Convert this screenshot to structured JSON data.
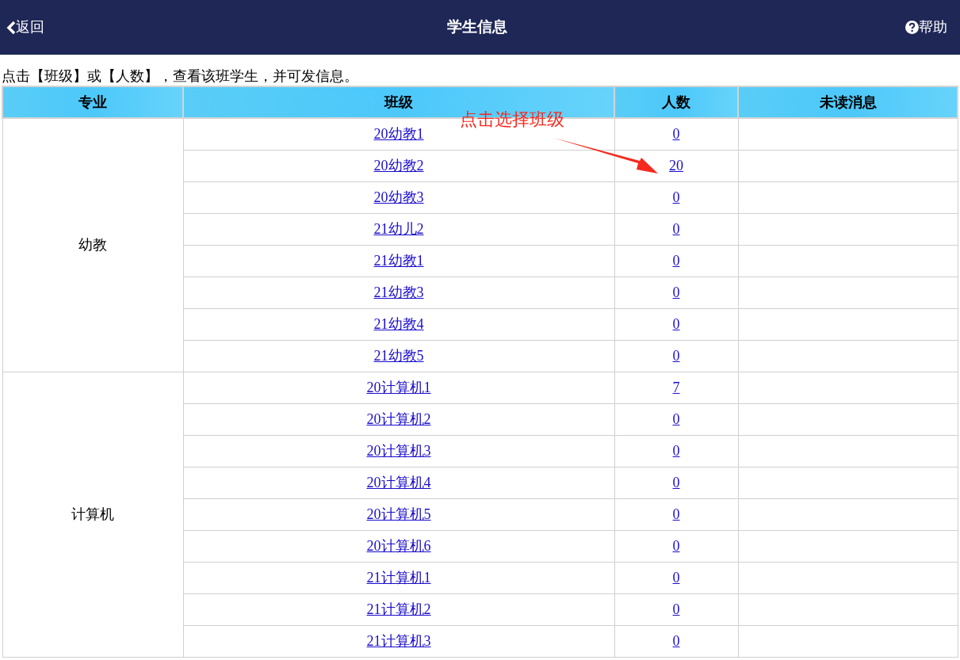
{
  "header": {
    "back": "返回",
    "title": "学生信息",
    "help": "帮助"
  },
  "instruction": "点击【班级】或【人数】，查看该班学生，并可发信息。",
  "table": {
    "columns": [
      "专业",
      "班级",
      "人数",
      "未读消息"
    ],
    "groups": [
      {
        "major": "幼教",
        "rows": [
          {
            "class": "20幼教1",
            "count": "0"
          },
          {
            "class": "20幼教2",
            "count": "20"
          },
          {
            "class": "20幼教3",
            "count": "0"
          },
          {
            "class": "21幼儿2",
            "count": "0"
          },
          {
            "class": "21幼教1",
            "count": "0"
          },
          {
            "class": "21幼教3",
            "count": "0"
          },
          {
            "class": "21幼教4",
            "count": "0"
          },
          {
            "class": "21幼教5",
            "count": "0"
          }
        ]
      },
      {
        "major": "计算机",
        "rows": [
          {
            "class": "20计算机1",
            "count": "7"
          },
          {
            "class": "20计算机2",
            "count": "0"
          },
          {
            "class": "20计算机3",
            "count": "0"
          },
          {
            "class": "20计算机4",
            "count": "0"
          },
          {
            "class": "20计算机5",
            "count": "0"
          },
          {
            "class": "20计算机6",
            "count": "0"
          },
          {
            "class": "21计算机1",
            "count": "0"
          },
          {
            "class": "21计算机2",
            "count": "0"
          },
          {
            "class": "21计算机3",
            "count": "0"
          }
        ]
      }
    ]
  },
  "annotation": {
    "text": "点击选择班级"
  }
}
